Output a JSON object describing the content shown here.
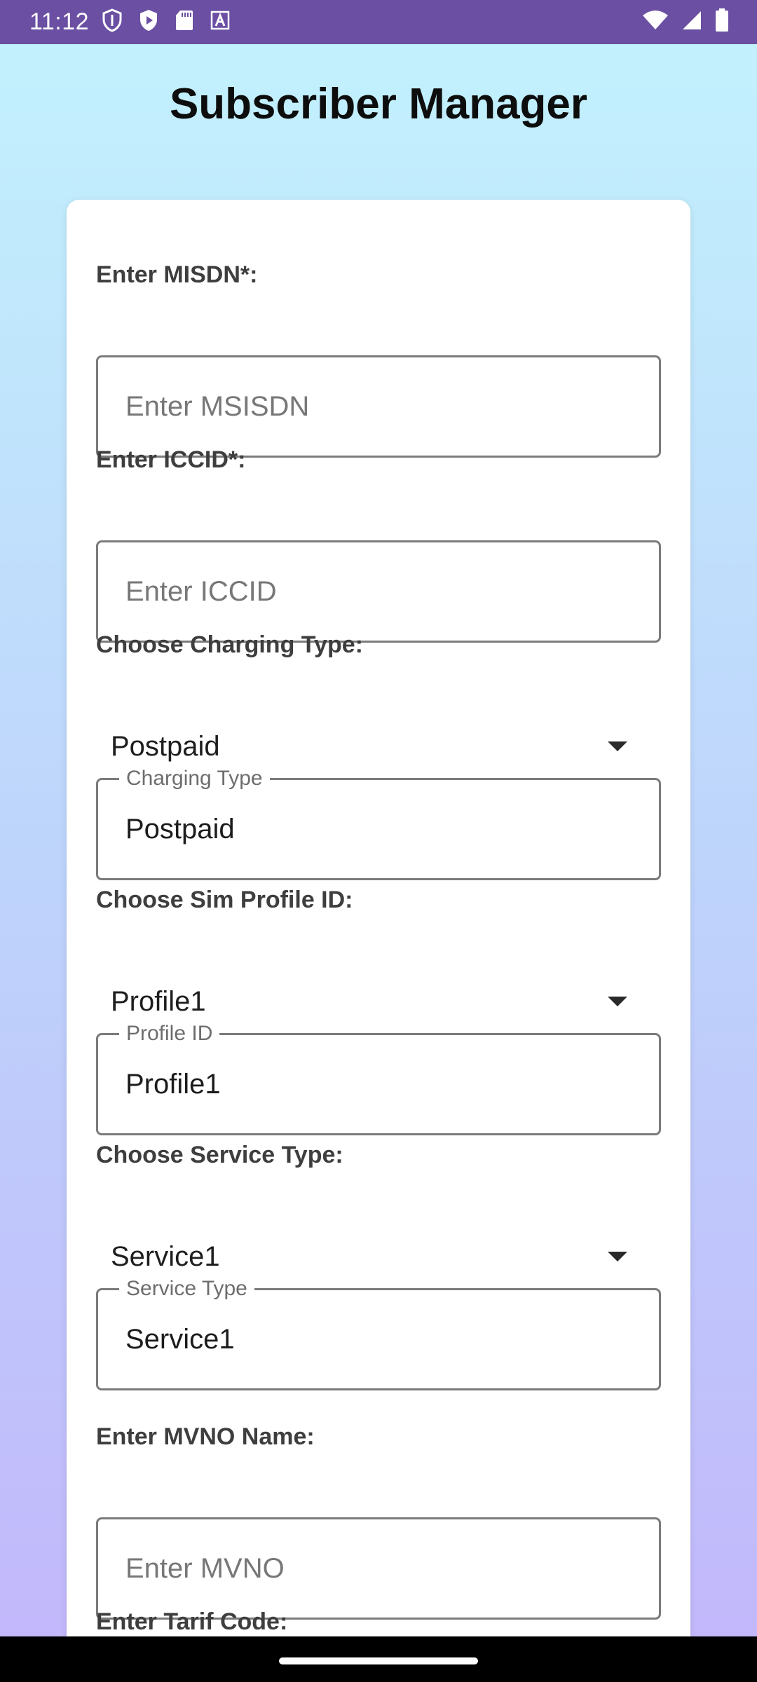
{
  "status_bar": {
    "time": "11:12",
    "icons_left": [
      "shield-icon",
      "play-icon",
      "sd-card-icon",
      "font-a-icon"
    ],
    "icons_right": [
      "wifi-icon",
      "cellular-signal-icon",
      "battery-icon"
    ]
  },
  "header": {
    "title": "Subscriber Manager"
  },
  "form": {
    "msisdn": {
      "label": "Enter MISDN*:",
      "placeholder": "Enter MSISDN"
    },
    "iccid": {
      "label": "Enter ICCID*:",
      "placeholder": "Enter ICCID"
    },
    "charging": {
      "label": "Choose Charging Type:",
      "selected": "Postpaid",
      "field_label": "Charging Type",
      "field_value": "Postpaid"
    },
    "profile": {
      "label": "Choose Sim Profile ID:",
      "selected": "Profile1",
      "field_label": "Profile ID",
      "field_value": "Profile1"
    },
    "service": {
      "label": "Choose Service Type:",
      "selected": "Service1",
      "field_label": "Service Type",
      "field_value": "Service1"
    },
    "mvno": {
      "label": "Enter MVNO Name:",
      "placeholder": "Enter MVNO"
    },
    "tarif": {
      "label": "Enter Tarif Code:"
    }
  },
  "colors": {
    "status_bar": "#6a4fa3",
    "gradient_top": "#c2f1fd",
    "gradient_bottom": "#c2b8fb",
    "card": "#ffffff"
  }
}
